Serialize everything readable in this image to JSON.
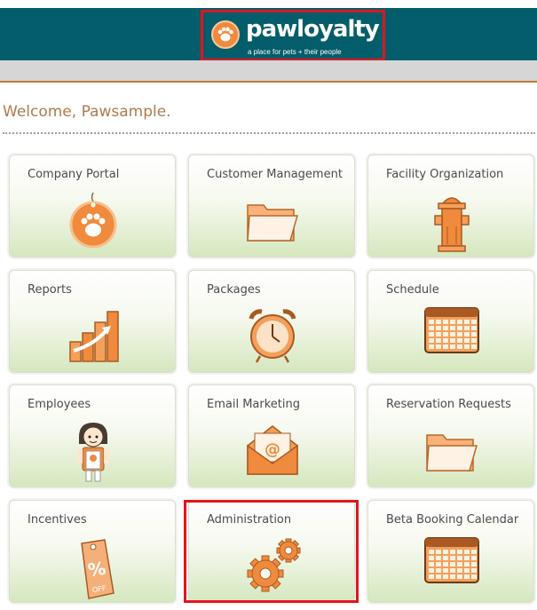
{
  "header": {
    "logo_text": "pawloyalty",
    "tagline": "a place for pets + their people",
    "color": "#035d6b"
  },
  "welcome": "Welcome, Pawsample.",
  "tiles": [
    {
      "label": "Company Portal",
      "icon": "paw-tag-icon"
    },
    {
      "label": "Customer Management",
      "icon": "folder-icon"
    },
    {
      "label": "Facility Organization",
      "icon": "fire-hydrant-icon"
    },
    {
      "label": "Reports",
      "icon": "growth-chart-icon"
    },
    {
      "label": "Packages",
      "icon": "alarm-clock-icon"
    },
    {
      "label": "Schedule",
      "icon": "calendar-icon"
    },
    {
      "label": "Employees",
      "icon": "employee-avatar-icon"
    },
    {
      "label": "Email Marketing",
      "icon": "email-envelope-icon"
    },
    {
      "label": "Reservation Requests",
      "icon": "folder-icon"
    },
    {
      "label": "Incentives",
      "icon": "discount-tag-icon"
    },
    {
      "label": "Administration",
      "icon": "gears-icon"
    },
    {
      "label": "Beta Booking Calendar",
      "icon": "calendar-icon"
    }
  ],
  "accent_color": "#f08a3c",
  "highlight_color": "#e0161e"
}
